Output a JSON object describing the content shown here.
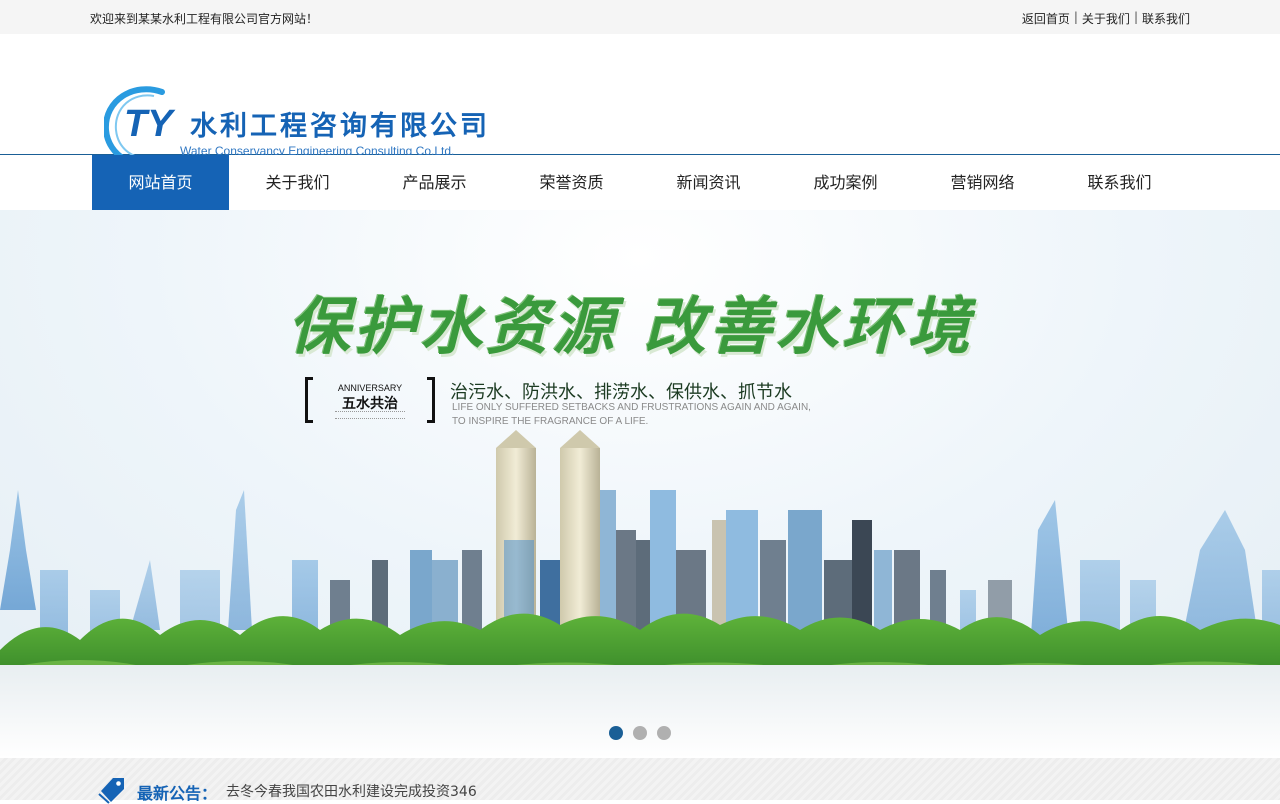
{
  "topbar": {
    "welcome": "欢迎来到某某水利工程有限公司官方网站！",
    "links": [
      "返回首页",
      "关于我们",
      "联系我们"
    ],
    "separator": "|"
  },
  "logo": {
    "mark": "TY",
    "cn_name": "水利工程咨询有限公司",
    "en_name": "Water Conservancy Engineering Consulting Co.Ltd."
  },
  "nav": {
    "items": [
      "网站首页",
      "关于我们",
      "产品展示",
      "荣誉资质",
      "新闻资讯",
      "成功案例",
      "营销网络",
      "联系我们"
    ],
    "active_index": 0,
    "active_color": "#1563b5"
  },
  "banner": {
    "slogan": "保护水资源  改善水环境",
    "badge_en": "ANNIVERSARY",
    "badge_cn": "五水共治",
    "subline": "治污水、防洪水、排涝水、保供水、抓节水",
    "english_line1": "LIFE ONLY SUFFERED SETBACKS AND FRUSTRATIONS AGAIN AND AGAIN,",
    "english_line2": "TO INSPIRE THE FRAGRANCE OF A LIFE.",
    "slide_count": 3,
    "active_slide": 1
  },
  "notice": {
    "icon": "tag-icon",
    "label": "最新公告：",
    "text": "去冬今春我国农田水利建设完成投资346"
  }
}
